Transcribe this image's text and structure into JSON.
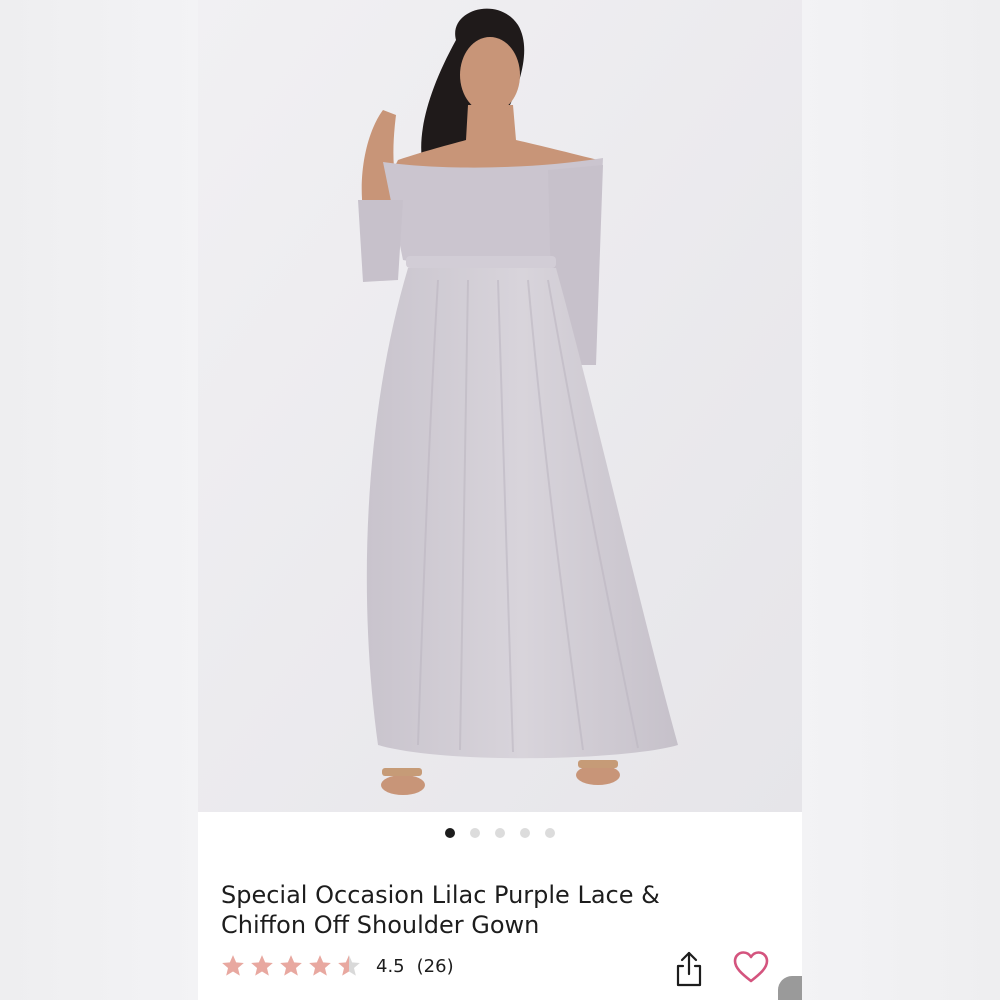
{
  "product": {
    "title_line1": "Special Occasion Lilac Purple Lace &",
    "title_line2": "Chiffon Off Shoulder Gown",
    "image_alt": "Model wearing lilac lace and chiffon off shoulder gown"
  },
  "carousel": {
    "count": 5,
    "active_index": 0
  },
  "rating": {
    "value": "4.5",
    "count": "(26)",
    "stars_out_of_5": 4.5,
    "star_color": "#e8a8a0",
    "star_empty_color": "#d9d9d9"
  },
  "icons": {
    "share": "share-icon",
    "favorite": "heart-icon"
  },
  "colors": {
    "heart": "#d4547e",
    "dress": "#cfcad3"
  }
}
